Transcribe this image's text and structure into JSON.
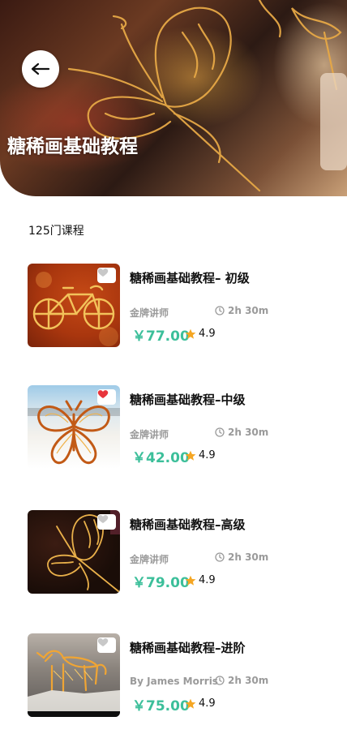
{
  "header": {
    "title": "糖稀画基础教程",
    "back_icon": "arrow-left-icon"
  },
  "course_count": "125门课程",
  "colors": {
    "price": "#3cbf9a",
    "star": "#f5a623",
    "heart_active": "#e8353c",
    "heart_inactive": "#c8c8c8"
  },
  "courses": [
    {
      "title": "糖稀画基础教程– 初级",
      "author": "金牌讲师",
      "duration": "2h 30m",
      "price": "￥77.00",
      "rating": "4.9",
      "favorited": false
    },
    {
      "title": "糖稀画基础教程–中级",
      "author": "金牌讲师",
      "duration": "2h 30m",
      "price": "￥42.00",
      "rating": "4.9",
      "favorited": true
    },
    {
      "title": "糖稀画基础教程–高级",
      "author": "金牌讲师",
      "duration": "2h 30m",
      "price": "￥79.00",
      "rating": "4.9",
      "favorited": false
    },
    {
      "title": "糖稀画基础教程–进阶",
      "author": "By James Morris",
      "duration": "2h 30m",
      "price": "￥75.00",
      "rating": "4.9",
      "favorited": false
    }
  ]
}
